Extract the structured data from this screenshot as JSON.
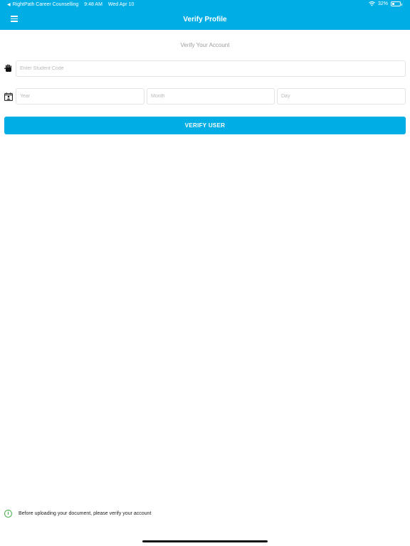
{
  "status_bar": {
    "back_app": "RightPath Career Counselling",
    "time": "9:48 AM",
    "date": "Wed Apr 10",
    "battery": "32%",
    "battery_level": 0.32
  },
  "nav": {
    "title": "Verify Profile",
    "menu_icon": "hamburger-menu-icon"
  },
  "form": {
    "subtitle": "Verify Your Account",
    "student_code": {
      "placeholder": "Enter Student Code",
      "value": ""
    },
    "dob": {
      "year_placeholder": "Year",
      "month_placeholder": "Month",
      "day_placeholder": "Day"
    },
    "verify_label": "VERIFY USER"
  },
  "footer": {
    "note": "Before uploading your document, please verify your account"
  },
  "colors": {
    "primary": "#00aee5",
    "info": "#4caf50"
  }
}
